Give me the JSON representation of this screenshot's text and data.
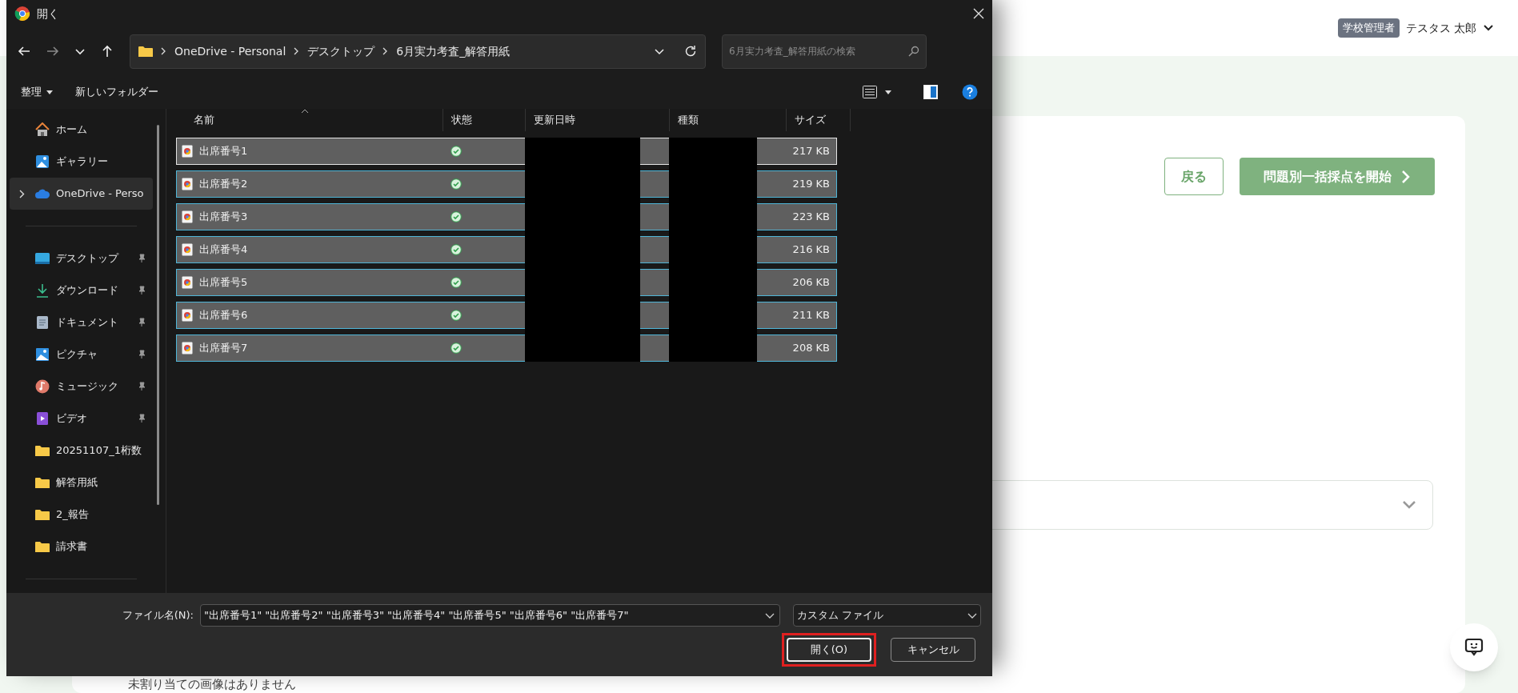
{
  "app": {
    "role_badge": "学校管理者",
    "user_name": "テスタス 太郎",
    "back_button": "戻る",
    "start_button": "問題別一括採点を開始",
    "footer_text": "未割り当ての画像はありません"
  },
  "dialog": {
    "title": "開く",
    "breadcrumb": [
      "OneDrive - Personal",
      "デスクトップ",
      "6月実力考査_解答用紙"
    ],
    "search": {
      "placeholder": "6月実力考査_解答用紙の検索"
    },
    "toolbar": [
      {
        "label": "整理",
        "kind": "menu"
      },
      {
        "label": "新しいフォルダー",
        "kind": "button"
      }
    ],
    "sidebar": {
      "groups": [
        {
          "items": [
            {
              "label": "ホーム",
              "kind": "home",
              "pinned": false,
              "selected": false,
              "expandable": false
            },
            {
              "label": "ギャラリー",
              "kind": "gallery",
              "pinned": false,
              "selected": false,
              "expandable": false
            },
            {
              "label": "OneDrive - Perso",
              "kind": "cloud",
              "pinned": false,
              "selected": true,
              "expandable": true
            }
          ]
        },
        {
          "items": [
            {
              "label": "デスクトップ",
              "kind": "desktop",
              "pinned": true,
              "selected": false,
              "expandable": false
            },
            {
              "label": "ダウンロード",
              "kind": "download",
              "pinned": true,
              "selected": false,
              "expandable": false
            },
            {
              "label": "ドキュメント",
              "kind": "document",
              "pinned": true,
              "selected": false,
              "expandable": false
            },
            {
              "label": "ピクチャ",
              "kind": "picture",
              "pinned": true,
              "selected": false,
              "expandable": false
            },
            {
              "label": "ミュージック",
              "kind": "music",
              "pinned": true,
              "selected": false,
              "expandable": false
            },
            {
              "label": "ビデオ",
              "kind": "video",
              "pinned": true,
              "selected": false,
              "expandable": false
            },
            {
              "label": "20251107_1桁数",
              "kind": "folder",
              "pinned": false,
              "selected": false,
              "expandable": false
            },
            {
              "label": "解答用紙",
              "kind": "folder",
              "pinned": false,
              "selected": false,
              "expandable": false
            },
            {
              "label": "2_報告",
              "kind": "folder",
              "pinned": false,
              "selected": false,
              "expandable": false
            },
            {
              "label": "請求書",
              "kind": "folder",
              "pinned": false,
              "selected": false,
              "expandable": false
            }
          ]
        }
      ]
    },
    "columns": [
      {
        "label": "名前",
        "sorted": true,
        "redacted": false
      },
      {
        "label": "状態",
        "sorted": false,
        "redacted": false
      },
      {
        "label": "更新日時",
        "sorted": false,
        "redacted": true
      },
      {
        "label": "種類",
        "sorted": false,
        "redacted": true
      },
      {
        "label": "サイズ",
        "sorted": false,
        "redacted": false
      }
    ],
    "files": [
      {
        "name": "出席番号1",
        "size": "217 KB",
        "synced": true,
        "selected": true,
        "focused": true
      },
      {
        "name": "出席番号2",
        "size": "219 KB",
        "synced": true,
        "selected": true,
        "focused": false
      },
      {
        "name": "出席番号3",
        "size": "223 KB",
        "synced": true,
        "selected": true,
        "focused": false
      },
      {
        "name": "出席番号4",
        "size": "216 KB",
        "synced": true,
        "selected": true,
        "focused": false
      },
      {
        "name": "出席番号5",
        "size": "206 KB",
        "synced": true,
        "selected": true,
        "focused": false
      },
      {
        "name": "出席番号6",
        "size": "211 KB",
        "synced": true,
        "selected": true,
        "focused": false
      },
      {
        "name": "出席番号7",
        "size": "208 KB",
        "synced": true,
        "selected": true,
        "focused": false
      }
    ],
    "file_name_label": "ファイル名(N):",
    "file_name_value": "\"出席番号1\" \"出席番号2\" \"出席番号3\" \"出席番号4\" \"出席番号5\" \"出席番号6\" \"出席番号7\"",
    "file_type": "カスタム ファイル",
    "buttons": [
      {
        "label": "開く(O)",
        "highlighted": true
      },
      {
        "label": "キャンセル",
        "highlighted": false
      }
    ]
  }
}
